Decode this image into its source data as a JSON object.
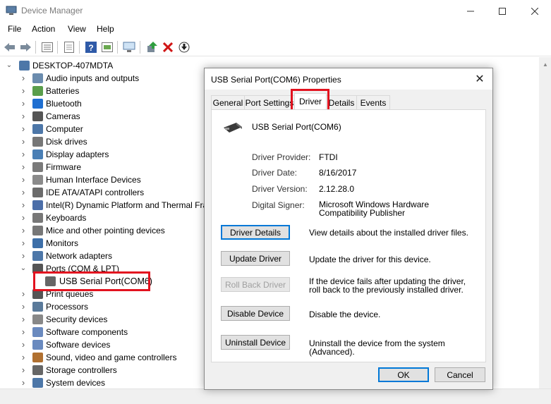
{
  "window": {
    "title": "Device Manager"
  },
  "menu": [
    "File",
    "Action",
    "View",
    "Help"
  ],
  "tree": {
    "root": "DESKTOP-407MDTA",
    "items": [
      {
        "label": "Audio inputs and outputs",
        "icon": "speaker-icon"
      },
      {
        "label": "Batteries",
        "icon": "battery-icon"
      },
      {
        "label": "Bluetooth",
        "icon": "bluetooth-icon"
      },
      {
        "label": "Cameras",
        "icon": "camera-icon"
      },
      {
        "label": "Computer",
        "icon": "computer-icon"
      },
      {
        "label": "Disk drives",
        "icon": "disk-drive-icon"
      },
      {
        "label": "Display adapters",
        "icon": "display-adapter-icon"
      },
      {
        "label": "Firmware",
        "icon": "firmware-icon"
      },
      {
        "label": "Human Interface Devices",
        "icon": "hid-icon"
      },
      {
        "label": "IDE ATA/ATAPI controllers",
        "icon": "ide-controller-icon"
      },
      {
        "label": "Intel(R) Dynamic Platform and Thermal Fra",
        "icon": "thermal-icon"
      },
      {
        "label": "Keyboards",
        "icon": "keyboard-icon"
      },
      {
        "label": "Mice and other pointing devices",
        "icon": "mouse-icon"
      },
      {
        "label": "Monitors",
        "icon": "monitor-icon"
      },
      {
        "label": "Network adapters",
        "icon": "network-icon"
      },
      {
        "label": "Ports (COM & LPT)",
        "icon": "port-icon"
      },
      {
        "label": "USB Serial Port(COM6)",
        "icon": "usb-serial-icon"
      },
      {
        "label": "Print queues",
        "icon": "printer-icon"
      },
      {
        "label": "Processors",
        "icon": "processor-icon"
      },
      {
        "label": "Security devices",
        "icon": "security-icon"
      },
      {
        "label": "Software components",
        "icon": "software-component-icon"
      },
      {
        "label": "Software devices",
        "icon": "software-device-icon"
      },
      {
        "label": "Sound, video and game controllers",
        "icon": "sound-icon"
      },
      {
        "label": "Storage controllers",
        "icon": "storage-icon"
      },
      {
        "label": "System devices",
        "icon": "system-icon"
      }
    ]
  },
  "dialog": {
    "title": "USB Serial Port(COM6) Properties",
    "close": "✕",
    "tabs": [
      "General",
      "Port Settings",
      "Driver",
      "Details",
      "Events"
    ],
    "active_tab": "Driver",
    "device_name": "USB Serial Port(COM6)",
    "fields": [
      {
        "label": "Driver Provider:",
        "value": "FTDI"
      },
      {
        "label": "Driver Date:",
        "value": "8/16/2017"
      },
      {
        "label": "Driver Version:",
        "value": "2.12.28.0"
      },
      {
        "label": "Digital Signer:",
        "value": "Microsoft Windows Hardware Compatibility Publisher"
      }
    ],
    "buttons": [
      {
        "label": "Driver Details",
        "desc": "View details about the installed driver files.",
        "enabled": true
      },
      {
        "label": "Update Driver",
        "desc": "Update the driver for this device.",
        "enabled": true
      },
      {
        "label": "Roll Back Driver",
        "desc": "If the device fails after updating the driver, roll back to the previously installed driver.",
        "enabled": false
      },
      {
        "label": "Disable Device",
        "desc": "Disable the device.",
        "enabled": true
      },
      {
        "label": "Uninstall Device",
        "desc": "Uninstall the device from the system (Advanced).",
        "enabled": true
      }
    ],
    "ok": "OK",
    "cancel": "Cancel"
  },
  "colors": {
    "highlight": "#e2121f",
    "accent": "#0078d7"
  }
}
